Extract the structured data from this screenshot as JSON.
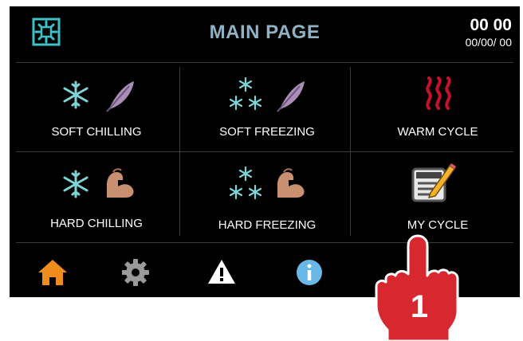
{
  "header": {
    "title": "MAIN PAGE",
    "time": "00 00",
    "date": "00/00/ 00",
    "logo_icon": "snowflake-logo-icon"
  },
  "cycles": [
    {
      "label": "SOFT CHILLING",
      "icons": [
        "snowflake-icon",
        "feather-icon"
      ]
    },
    {
      "label": "SOFT FREEZING",
      "icons": [
        "triple-snowflake-icon",
        "feather-icon"
      ]
    },
    {
      "label": "WARM CYCLE",
      "icons": [
        "heat-waves-icon"
      ]
    },
    {
      "label": "HARD CHILLING",
      "icons": [
        "snowflake-icon",
        "flexed-arm-icon"
      ]
    },
    {
      "label": "HARD FREEZING",
      "icons": [
        "triple-snowflake-icon",
        "flexed-arm-icon"
      ]
    },
    {
      "label": "MY CYCLE",
      "icons": [
        "notepad-pencil-icon"
      ]
    }
  ],
  "nav": [
    "home-icon",
    "settings-gear-icon",
    "warning-icon",
    "info-icon"
  ],
  "annotation": {
    "step": "1",
    "icon": "pointing-hand-icon"
  },
  "colors": {
    "background": "#000000",
    "title": "#8fb3c4",
    "snowflake": "#7fd3d6",
    "home": "#f08c1e",
    "info": "#69b7e6",
    "heat": "#c8102e",
    "hand": "#d7282f"
  }
}
